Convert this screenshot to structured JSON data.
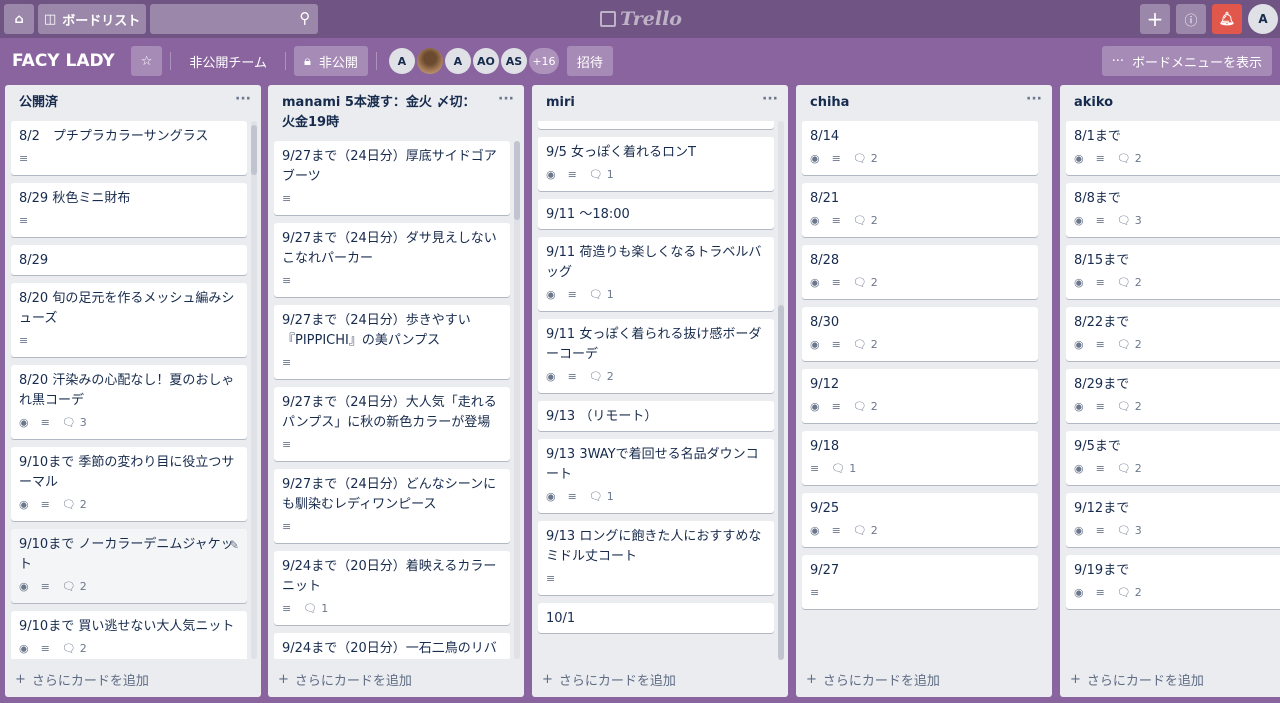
{
  "topbar": {
    "home_label": "",
    "boards_label": "ボードリスト",
    "search_placeholder": "",
    "logo_text": "Trello",
    "user_initial": "A"
  },
  "board": {
    "title": "FACY LADY",
    "team": "非公開チーム",
    "visibility": "非公開",
    "members": [
      "A",
      "",
      "A",
      "AO",
      "AS"
    ],
    "more_members": "+16",
    "invite": "招待",
    "menu": "ボードメニューを表示"
  },
  "add_card_label": "さらにカードを追加",
  "lists": [
    {
      "title": "公開済",
      "cards": [
        {
          "title": "8/2　プチプラカラーサングラス",
          "desc": true
        },
        {
          "title": "8/29 秋色ミニ財布",
          "desc": true
        },
        {
          "title": "8/29"
        },
        {
          "title": "8/20 旬の足元を作るメッシュ編みシューズ",
          "desc": true
        },
        {
          "title": "8/20 汗染みの心配なし！夏のおしゃれ黒コーデ",
          "watch": true,
          "desc": true,
          "comments": "3"
        },
        {
          "title": "9/10まで 季節の変わり目に役立つサーマル",
          "watch": true,
          "desc": true,
          "comments": "2"
        },
        {
          "title": "9/10まで ノーカラーデニムジャケット",
          "watch": true,
          "desc": true,
          "comments": "2",
          "hover": true
        },
        {
          "title": "9/10まで 買い逃せない大人気ニット",
          "watch": true,
          "desc": true,
          "comments": "2"
        }
      ]
    },
    {
      "title": "manami 5本渡す：金火 〆切：火金19時",
      "cards": [
        {
          "title": "9/27まで（24日分）厚底サイドゴアブーツ",
          "desc": true
        },
        {
          "title": "9/27まで（24日分）ダサ見えしないこなれパーカー",
          "desc": true
        },
        {
          "title": "9/27まで（24日分）歩きやすい『PIPPICHI』の美パンプス",
          "desc": true
        },
        {
          "title": "9/27まで（24日分）大人気「走れるパンプス」に秋の新色カラーが登場",
          "desc": true
        },
        {
          "title": "9/27まで（24日分）どんなシーンにも馴染むレディワンピース",
          "desc": true
        },
        {
          "title": "9/24まで（20日分）着映えるカラーニット",
          "desc": true,
          "comments": "1"
        },
        {
          "title": "9/24まで（20日分）一石二鳥のリバーシブル",
          "desc": true
        }
      ]
    },
    {
      "title": "miri",
      "cards": [
        {
          "title": "9/5（リモート）15:00〜"
        },
        {
          "title": "9/5 女っぽく着れるロンT",
          "watch": true,
          "desc": true,
          "comments": "1"
        },
        {
          "title": "9/11 〜18:00"
        },
        {
          "title": "9/11 荷造りも楽しくなるトラベルバッグ",
          "watch": true,
          "desc": true,
          "comments": "1"
        },
        {
          "title": "9/11 女っぽく着られる抜け感ボーダーコーデ",
          "watch": true,
          "desc": true,
          "comments": "2"
        },
        {
          "title": "9/13 （リモート）"
        },
        {
          "title": "9/13 3WAYで着回せる名品ダウンコート",
          "watch": true,
          "desc": true,
          "comments": "1"
        },
        {
          "title": "9/13 ロングに飽きた人におすすめなミドル丈コート",
          "desc": true
        },
        {
          "title": "10/1"
        }
      ]
    },
    {
      "title": "chiha",
      "cards": [
        {
          "title": "8/14",
          "watch": true,
          "desc": true,
          "comments": "2"
        },
        {
          "title": "8/21",
          "watch": true,
          "desc": true,
          "comments": "2"
        },
        {
          "title": "8/28",
          "watch": true,
          "desc": true,
          "comments": "2"
        },
        {
          "title": "8/30",
          "watch": true,
          "desc": true,
          "comments": "2"
        },
        {
          "title": "9/12",
          "watch": true,
          "desc": true,
          "comments": "2"
        },
        {
          "title": "9/18",
          "desc": true,
          "comments": "1"
        },
        {
          "title": "9/25",
          "watch": true,
          "desc": true,
          "comments": "2"
        },
        {
          "title": "9/27",
          "desc": true
        }
      ]
    },
    {
      "title": "akiko",
      "cards": [
        {
          "title": "8/1まで",
          "watch": true,
          "desc": true,
          "comments": "2"
        },
        {
          "title": "8/8まで",
          "watch": true,
          "desc": true,
          "comments": "3"
        },
        {
          "title": "8/15まで",
          "watch": true,
          "desc": true,
          "comments": "2"
        },
        {
          "title": "8/22まで",
          "watch": true,
          "desc": true,
          "comments": "2"
        },
        {
          "title": "8/29まで",
          "watch": true,
          "desc": true,
          "comments": "2"
        },
        {
          "title": "9/5まで",
          "watch": true,
          "desc": true,
          "comments": "2"
        },
        {
          "title": "9/12まで",
          "watch": true,
          "desc": true,
          "comments": "3"
        },
        {
          "title": "9/19まで",
          "watch": true,
          "desc": true,
          "comments": "2"
        }
      ]
    }
  ]
}
